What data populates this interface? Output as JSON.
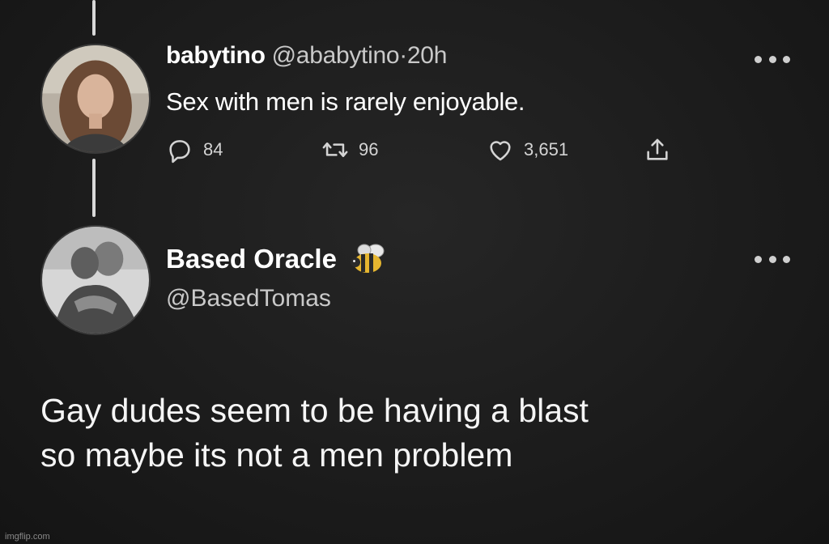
{
  "tweets": [
    {
      "display_name": "babytino",
      "handle": "@ababytino",
      "separator": "·",
      "time": "20h",
      "text": "Sex with men is rarely enjoyable.",
      "actions": {
        "replies": "84",
        "retweets": "96",
        "likes": "3,651"
      },
      "icons": [
        "reply-icon",
        "retweet-icon",
        "like-icon",
        "share-icon",
        "more-icon"
      ]
    },
    {
      "display_name": "Based Oracle",
      "handle": "@BasedTomas",
      "name_emoji": "bee-icon",
      "text_line_1": "Gay dudes seem to be having a blast",
      "text_line_2": "so maybe its not a men problem",
      "icons": [
        "more-icon"
      ]
    }
  ],
  "watermark": "imgflip.com",
  "colors": {
    "background": "#1c1c1c",
    "text_primary": "#ffffff",
    "text_secondary": "#c9c9c9"
  }
}
